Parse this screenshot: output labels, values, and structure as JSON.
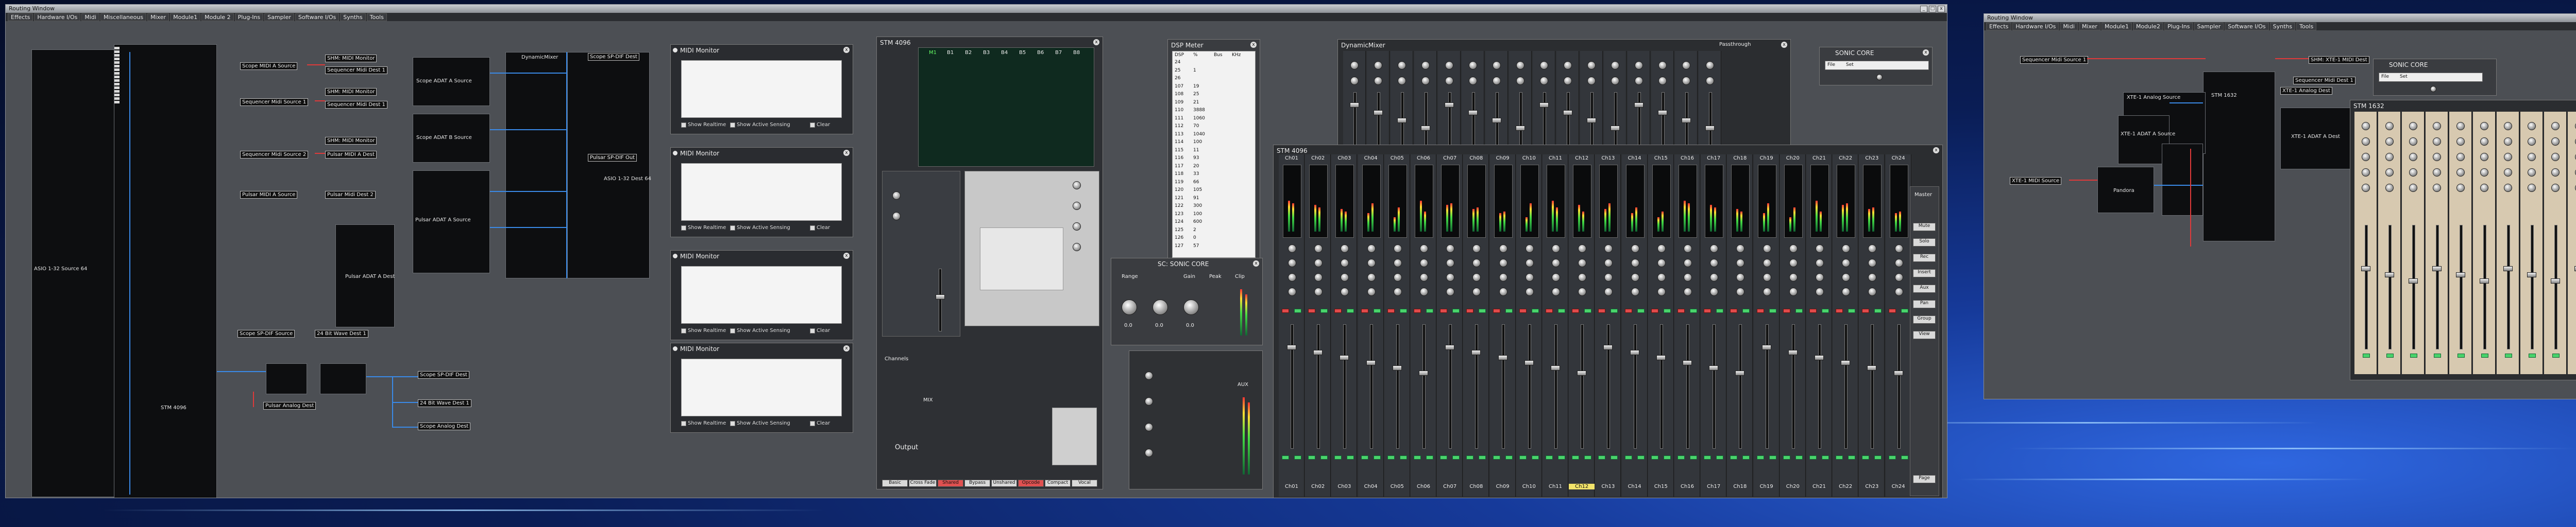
{
  "window_title": "Routing Window",
  "menu": [
    "Effects",
    "Hardware I/Os",
    "Midi",
    "Miscellaneous",
    "Mixer",
    "Module1",
    "Module 2",
    "Plug-Ins",
    "Sampler",
    "Software I/Os",
    "Synths",
    "Tools"
  ],
  "window_buttons": [
    "_",
    "□",
    "x"
  ],
  "second_window": {
    "title": "Routing Window",
    "menu": [
      "Effects",
      "Hardware I/Os",
      "Midi",
      "Mixer",
      "Module1",
      "Module2",
      "Plug-Ins",
      "Sampler",
      "Software I/Os",
      "Synths",
      "Tools"
    ]
  },
  "nodes": {
    "asio_source": "ASIO 1-32 Source 64",
    "stm_out": "STM 4096",
    "scope_midi_a_src": "Scope MIDI A Source",
    "scope_midi_a_dest": "SHM: MIDI Monitor",
    "seq_midi_src": "Sequencer Midi Source 1",
    "seq_midi_dest": "Sequencer Midi Dest 1",
    "scope_adat_a_src": "Scope ADAT A Source",
    "scope_adat_b_src": "Scope ADAT B Source",
    "pulsar_adat_a": "Pulsar ADAT A Source",
    "pulsar_adat_a_dest": "Pulsar ADAT A Dest",
    "seq_midi_src2": "Sequencer Midi Source 2",
    "pulsar_midi_dest": "Pulsar MIDI A Dest",
    "pulsar_midi_src": "Pulsar MIDI A Source",
    "pulsar_midi_dest2": "Pulsar Midi Dest 2",
    "dynamic_mixer": "DynamicMixer",
    "asio_dest": "ASIO 1-32 Dest 64",
    "scope_spdif_src": "Scope SP-DIF Source",
    "wave_dest": "24 Bit Wave Dest 1",
    "pulsar_analog_dest": "Pulsar Analog Dest",
    "scope_analog_dest": "Scope Analog Dest",
    "scope_spdif_dest": "Scope SP-DIF Dest",
    "pulsar_spdif_out": "Pulsar SP-DIF Out",
    "midi_monitor_1": "SHM: MIDI Monitor",
    "midi_monitor_2": "SHM: MIDI Monitor"
  },
  "midi_monitors": [
    {
      "title": "MIDI Monitor",
      "show_realtime": "Show Realtime",
      "show_active": "Show Active Sensing",
      "clear": "Clear"
    },
    {
      "title": "MIDI Monitor",
      "show_realtime": "Show Realtime",
      "show_active": "Show Active Sensing",
      "clear": "Clear"
    },
    {
      "title": "MIDI Monitor",
      "show_realtime": "Show Realtime",
      "show_active": "Show Active Sensing",
      "clear": "Clear"
    },
    {
      "title": "MIDI Monitor",
      "show_realtime": "Show Realtime",
      "show_active": "Show Active Sensing",
      "clear": "Clear"
    }
  ],
  "stm_mixer": {
    "title": "STM 4096",
    "bus_labels": [
      "M1",
      "B1",
      "B2",
      "B3",
      "B4",
      "B5",
      "B6",
      "B7",
      "B8"
    ],
    "bottom_buttons": [
      "Basic",
      "Cross Fade",
      "Shared",
      "Bypass",
      "Unshared",
      "Opcode",
      "Compact",
      "Vocal"
    ],
    "channels_label": "Channels",
    "output_label": "Output",
    "mix_label": "MIX"
  },
  "dsp_meter": {
    "title": "DSP Meter",
    "headers": [
      "DSP",
      "%",
      "Bus",
      "KHz"
    ],
    "rows": [
      [
        "24",
        ""
      ],
      [
        "25",
        "1"
      ],
      [
        "26",
        ""
      ],
      [
        "107",
        "19"
      ],
      [
        "108",
        "25"
      ],
      [
        "109",
        "21"
      ],
      [
        "110",
        "3888"
      ],
      [
        "111",
        "1060"
      ],
      [
        "112",
        "70"
      ],
      [
        "113",
        "1040"
      ],
      [
        "114",
        "100"
      ],
      [
        "115",
        "11"
      ],
      [
        "116",
        "93"
      ],
      [
        "117",
        "20"
      ],
      [
        "118",
        "33"
      ],
      [
        "119",
        "66"
      ],
      [
        "120",
        "105"
      ],
      [
        "121",
        "91"
      ],
      [
        "122",
        "300"
      ],
      [
        "123",
        "100"
      ],
      [
        "124",
        "600"
      ],
      [
        "125",
        "2"
      ],
      [
        "126",
        "0"
      ],
      [
        "127",
        "57"
      ]
    ]
  },
  "sonic_core": {
    "title": "SC: SONIC CORE",
    "labels": [
      "Range",
      "Gain",
      "Peak",
      "Clip"
    ],
    "values": [
      "0.0",
      "0.0",
      "0.0"
    ],
    "file_label": "File",
    "set_label": "Set"
  },
  "sonic_core_small": {
    "title": "SONIC CORE",
    "file": "File",
    "set": "Set"
  },
  "dynamic_mixer": {
    "title": "DynamicMixer",
    "passthru": "Passthrough"
  },
  "big_mixer": {
    "title": "STM 4096",
    "channels": [
      "Ch01",
      "Ch02",
      "Ch03",
      "Ch04",
      "Ch05",
      "Ch06",
      "Ch07",
      "Ch08",
      "Ch09",
      "Ch10",
      "Ch11",
      "Ch12",
      "Ch13",
      "Ch14",
      "Ch15",
      "Ch16",
      "Ch17",
      "Ch18",
      "Ch19",
      "Ch20",
      "Ch21",
      "Ch22",
      "Ch23",
      "Ch24"
    ],
    "bottom_channels": [
      "Ch01",
      "Ch02",
      "Ch03",
      "Ch04",
      "Ch05",
      "Ch06",
      "Ch07",
      "Ch08",
      "Ch09",
      "Ch10",
      "Ch11",
      "Ch12",
      "Ch13",
      "Ch14",
      "Ch15",
      "Ch16",
      "Ch17",
      "Ch18",
      "Ch19",
      "Ch20",
      "Ch21",
      "Ch22",
      "Ch23",
      "Ch24"
    ],
    "selected_channel": "Ch12",
    "side_buttons": [
      "Mute",
      "Solo",
      "Rec",
      "Insert",
      "Aux",
      "Pan",
      "Group",
      "View",
      "Page"
    ],
    "master_label": "Master",
    "aux_label": "AUX"
  },
  "right_window": {
    "seq_src": "Sequencer Midi Source 1",
    "stm_node": "STM 1632",
    "analog_dest": "XTE-1 Analog Dest",
    "analog_src": "XTE-1 Analog Source",
    "adat_src": "XTE-1 ADAT A Source",
    "adat_dest": "XTE-1 ADAT A Dest",
    "midi_src": "XTE-1 MIDI Source",
    "seq_dest": "Sequencer Midi Dest 1",
    "pandora": "Pandora",
    "midi_dest": "SHM: XTE-1 MIDI Dest",
    "stm_title": "STM 1632",
    "sonic": "SONIC CORE"
  },
  "colors": {
    "wire_red": "#e03a3a",
    "wire_blue": "#3a8ae8",
    "led_green": "#49d36b",
    "desktop": "#163a9a"
  }
}
